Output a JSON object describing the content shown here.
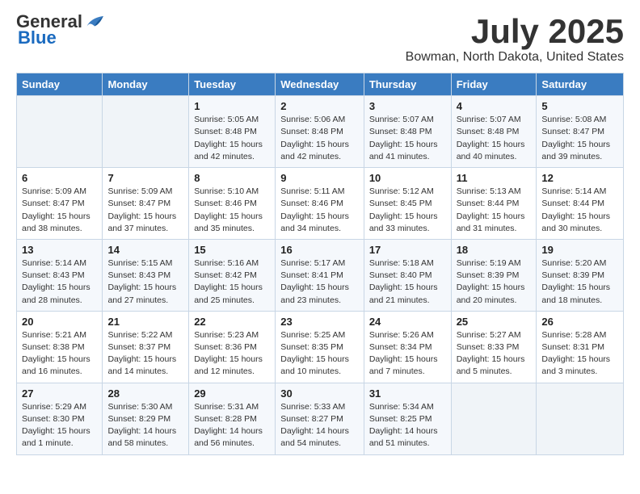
{
  "header": {
    "logo_general": "General",
    "logo_blue": "Blue",
    "month": "July 2025",
    "location": "Bowman, North Dakota, United States"
  },
  "days_of_week": [
    "Sunday",
    "Monday",
    "Tuesday",
    "Wednesday",
    "Thursday",
    "Friday",
    "Saturday"
  ],
  "weeks": [
    [
      {
        "day": "",
        "sunrise": "",
        "sunset": "",
        "daylight": ""
      },
      {
        "day": "",
        "sunrise": "",
        "sunset": "",
        "daylight": ""
      },
      {
        "day": "1",
        "sunrise": "Sunrise: 5:05 AM",
        "sunset": "Sunset: 8:48 PM",
        "daylight": "Daylight: 15 hours and 42 minutes."
      },
      {
        "day": "2",
        "sunrise": "Sunrise: 5:06 AM",
        "sunset": "Sunset: 8:48 PM",
        "daylight": "Daylight: 15 hours and 42 minutes."
      },
      {
        "day": "3",
        "sunrise": "Sunrise: 5:07 AM",
        "sunset": "Sunset: 8:48 PM",
        "daylight": "Daylight: 15 hours and 41 minutes."
      },
      {
        "day": "4",
        "sunrise": "Sunrise: 5:07 AM",
        "sunset": "Sunset: 8:48 PM",
        "daylight": "Daylight: 15 hours and 40 minutes."
      },
      {
        "day": "5",
        "sunrise": "Sunrise: 5:08 AM",
        "sunset": "Sunset: 8:47 PM",
        "daylight": "Daylight: 15 hours and 39 minutes."
      }
    ],
    [
      {
        "day": "6",
        "sunrise": "Sunrise: 5:09 AM",
        "sunset": "Sunset: 8:47 PM",
        "daylight": "Daylight: 15 hours and 38 minutes."
      },
      {
        "day": "7",
        "sunrise": "Sunrise: 5:09 AM",
        "sunset": "Sunset: 8:47 PM",
        "daylight": "Daylight: 15 hours and 37 minutes."
      },
      {
        "day": "8",
        "sunrise": "Sunrise: 5:10 AM",
        "sunset": "Sunset: 8:46 PM",
        "daylight": "Daylight: 15 hours and 35 minutes."
      },
      {
        "day": "9",
        "sunrise": "Sunrise: 5:11 AM",
        "sunset": "Sunset: 8:46 PM",
        "daylight": "Daylight: 15 hours and 34 minutes."
      },
      {
        "day": "10",
        "sunrise": "Sunrise: 5:12 AM",
        "sunset": "Sunset: 8:45 PM",
        "daylight": "Daylight: 15 hours and 33 minutes."
      },
      {
        "day": "11",
        "sunrise": "Sunrise: 5:13 AM",
        "sunset": "Sunset: 8:44 PM",
        "daylight": "Daylight: 15 hours and 31 minutes."
      },
      {
        "day": "12",
        "sunrise": "Sunrise: 5:14 AM",
        "sunset": "Sunset: 8:44 PM",
        "daylight": "Daylight: 15 hours and 30 minutes."
      }
    ],
    [
      {
        "day": "13",
        "sunrise": "Sunrise: 5:14 AM",
        "sunset": "Sunset: 8:43 PM",
        "daylight": "Daylight: 15 hours and 28 minutes."
      },
      {
        "day": "14",
        "sunrise": "Sunrise: 5:15 AM",
        "sunset": "Sunset: 8:43 PM",
        "daylight": "Daylight: 15 hours and 27 minutes."
      },
      {
        "day": "15",
        "sunrise": "Sunrise: 5:16 AM",
        "sunset": "Sunset: 8:42 PM",
        "daylight": "Daylight: 15 hours and 25 minutes."
      },
      {
        "day": "16",
        "sunrise": "Sunrise: 5:17 AM",
        "sunset": "Sunset: 8:41 PM",
        "daylight": "Daylight: 15 hours and 23 minutes."
      },
      {
        "day": "17",
        "sunrise": "Sunrise: 5:18 AM",
        "sunset": "Sunset: 8:40 PM",
        "daylight": "Daylight: 15 hours and 21 minutes."
      },
      {
        "day": "18",
        "sunrise": "Sunrise: 5:19 AM",
        "sunset": "Sunset: 8:39 PM",
        "daylight": "Daylight: 15 hours and 20 minutes."
      },
      {
        "day": "19",
        "sunrise": "Sunrise: 5:20 AM",
        "sunset": "Sunset: 8:39 PM",
        "daylight": "Daylight: 15 hours and 18 minutes."
      }
    ],
    [
      {
        "day": "20",
        "sunrise": "Sunrise: 5:21 AM",
        "sunset": "Sunset: 8:38 PM",
        "daylight": "Daylight: 15 hours and 16 minutes."
      },
      {
        "day": "21",
        "sunrise": "Sunrise: 5:22 AM",
        "sunset": "Sunset: 8:37 PM",
        "daylight": "Daylight: 15 hours and 14 minutes."
      },
      {
        "day": "22",
        "sunrise": "Sunrise: 5:23 AM",
        "sunset": "Sunset: 8:36 PM",
        "daylight": "Daylight: 15 hours and 12 minutes."
      },
      {
        "day": "23",
        "sunrise": "Sunrise: 5:25 AM",
        "sunset": "Sunset: 8:35 PM",
        "daylight": "Daylight: 15 hours and 10 minutes."
      },
      {
        "day": "24",
        "sunrise": "Sunrise: 5:26 AM",
        "sunset": "Sunset: 8:34 PM",
        "daylight": "Daylight: 15 hours and 7 minutes."
      },
      {
        "day": "25",
        "sunrise": "Sunrise: 5:27 AM",
        "sunset": "Sunset: 8:33 PM",
        "daylight": "Daylight: 15 hours and 5 minutes."
      },
      {
        "day": "26",
        "sunrise": "Sunrise: 5:28 AM",
        "sunset": "Sunset: 8:31 PM",
        "daylight": "Daylight: 15 hours and 3 minutes."
      }
    ],
    [
      {
        "day": "27",
        "sunrise": "Sunrise: 5:29 AM",
        "sunset": "Sunset: 8:30 PM",
        "daylight": "Daylight: 15 hours and 1 minute."
      },
      {
        "day": "28",
        "sunrise": "Sunrise: 5:30 AM",
        "sunset": "Sunset: 8:29 PM",
        "daylight": "Daylight: 14 hours and 58 minutes."
      },
      {
        "day": "29",
        "sunrise": "Sunrise: 5:31 AM",
        "sunset": "Sunset: 8:28 PM",
        "daylight": "Daylight: 14 hours and 56 minutes."
      },
      {
        "day": "30",
        "sunrise": "Sunrise: 5:33 AM",
        "sunset": "Sunset: 8:27 PM",
        "daylight": "Daylight: 14 hours and 54 minutes."
      },
      {
        "day": "31",
        "sunrise": "Sunrise: 5:34 AM",
        "sunset": "Sunset: 8:25 PM",
        "daylight": "Daylight: 14 hours and 51 minutes."
      },
      {
        "day": "",
        "sunrise": "",
        "sunset": "",
        "daylight": ""
      },
      {
        "day": "",
        "sunrise": "",
        "sunset": "",
        "daylight": ""
      }
    ]
  ]
}
